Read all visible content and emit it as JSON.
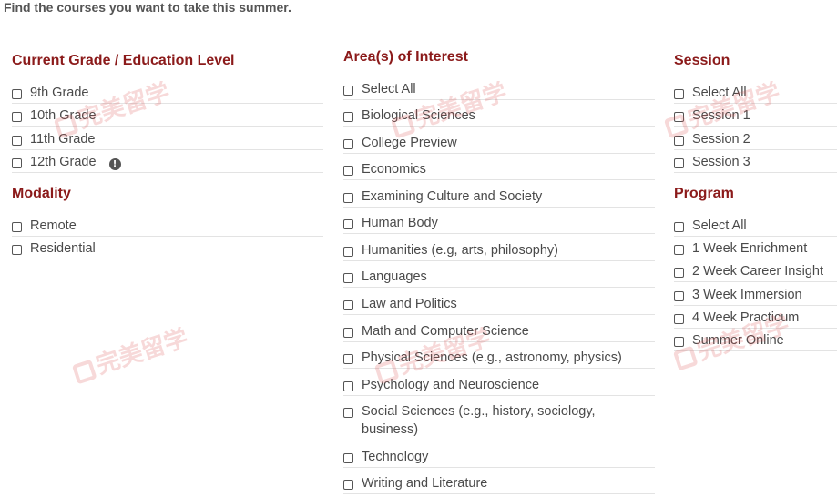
{
  "intro": "Find the courses you want to take this summer.",
  "grade": {
    "heading": "Current Grade / Education Level",
    "options": [
      "9th Grade",
      "10th Grade",
      "11th Grade",
      "12th Grade"
    ],
    "info_icon": "info-icon",
    "info_glyph": "!"
  },
  "modality": {
    "heading": "Modality",
    "options": [
      "Remote",
      "Residential"
    ]
  },
  "interest": {
    "heading": "Area(s) of Interest",
    "options": [
      "Select All",
      "Biological Sciences",
      "College Preview",
      "Economics",
      "Examining Culture and Society",
      "Human Body",
      "Humanities (e.g, arts, philosophy)",
      "Languages",
      "Law and Politics",
      "Math and Computer Science",
      "Physical Sciences (e.g., astronomy, physics)",
      "Psychology and Neuroscience",
      "Social Sciences (e.g., history, sociology, business)",
      "Technology",
      "Writing and Literature"
    ]
  },
  "session": {
    "heading": "Session",
    "options": [
      "Select All",
      "Session 1",
      "Session 2",
      "Session 3"
    ]
  },
  "program": {
    "heading": "Program",
    "options": [
      "Select All",
      "1 Week Enrichment",
      "2 Week Career Insight",
      "3 Week Immersion",
      "4 Week Practicum",
      "Summer Online"
    ]
  },
  "watermark": "完美留学",
  "colors": {
    "heading": "#8b1a1a",
    "text": "#4a4a4a",
    "divider": "#e3e3e3",
    "watermark": "#dc5050"
  }
}
